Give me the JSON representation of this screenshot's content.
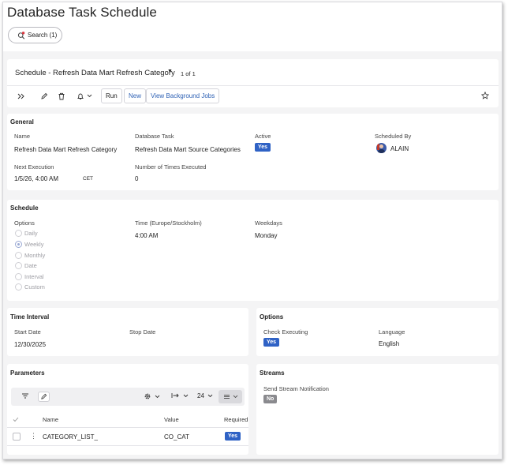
{
  "page": {
    "title": "Database Task Schedule"
  },
  "search": {
    "label": "Search (1)",
    "icon": "search-filter-icon"
  },
  "record": {
    "title": "Schedule - Refresh Data Mart Refresh Category",
    "page_count": "1 of 1",
    "toolbar": {
      "run": "Run",
      "new": "New",
      "view_jobs": "View Background Jobs"
    }
  },
  "general": {
    "title": "General",
    "name_label": "Name",
    "name_value": "Refresh Data Mart Refresh Category",
    "task_label": "Database Task",
    "task_value": "Refresh Data Mart Source Categories",
    "active_label": "Active",
    "active_value": "Yes",
    "sched_by_label": "Scheduled By",
    "sched_by_value": "ALAIN",
    "next_exec_label": "Next Execution",
    "next_exec_value": "1/5/26, 4:00 AM",
    "next_exec_tz": "CET",
    "times_label": "Number of Times Executed",
    "times_value": "0"
  },
  "schedule": {
    "title": "Schedule",
    "options_label": "Options",
    "options": [
      "Daily",
      "Weekly",
      "Monthly",
      "Date",
      "Interval",
      "Custom"
    ],
    "selected_option": "Weekly",
    "time_label": "Time (Europe/Stockholm)",
    "time_value": "4:00 AM",
    "weekdays_label": "Weekdays",
    "weekdays_value": "Monday"
  },
  "time_interval": {
    "title": "Time Interval",
    "start_label": "Start Date",
    "start_value": "12/30/2025",
    "stop_label": "Stop Date"
  },
  "options_section": {
    "title": "Options",
    "check_label": "Check Executing",
    "check_value": "Yes",
    "lang_label": "Language",
    "lang_value": "English"
  },
  "parameters": {
    "title": "Parameters",
    "page_size": "24",
    "columns": {
      "name": "Name",
      "value": "Value",
      "required": "Required"
    },
    "rows": [
      {
        "name": "CATEGORY_LIST_",
        "value": "CO_CAT",
        "required": "Yes"
      }
    ]
  },
  "streams": {
    "title": "Streams",
    "notif_label": "Send Stream Notification",
    "notif_value": "No"
  },
  "colors": {
    "accent": "#2f62c5",
    "link": "#2f62b5",
    "badge_no": "#8a8a8e"
  }
}
